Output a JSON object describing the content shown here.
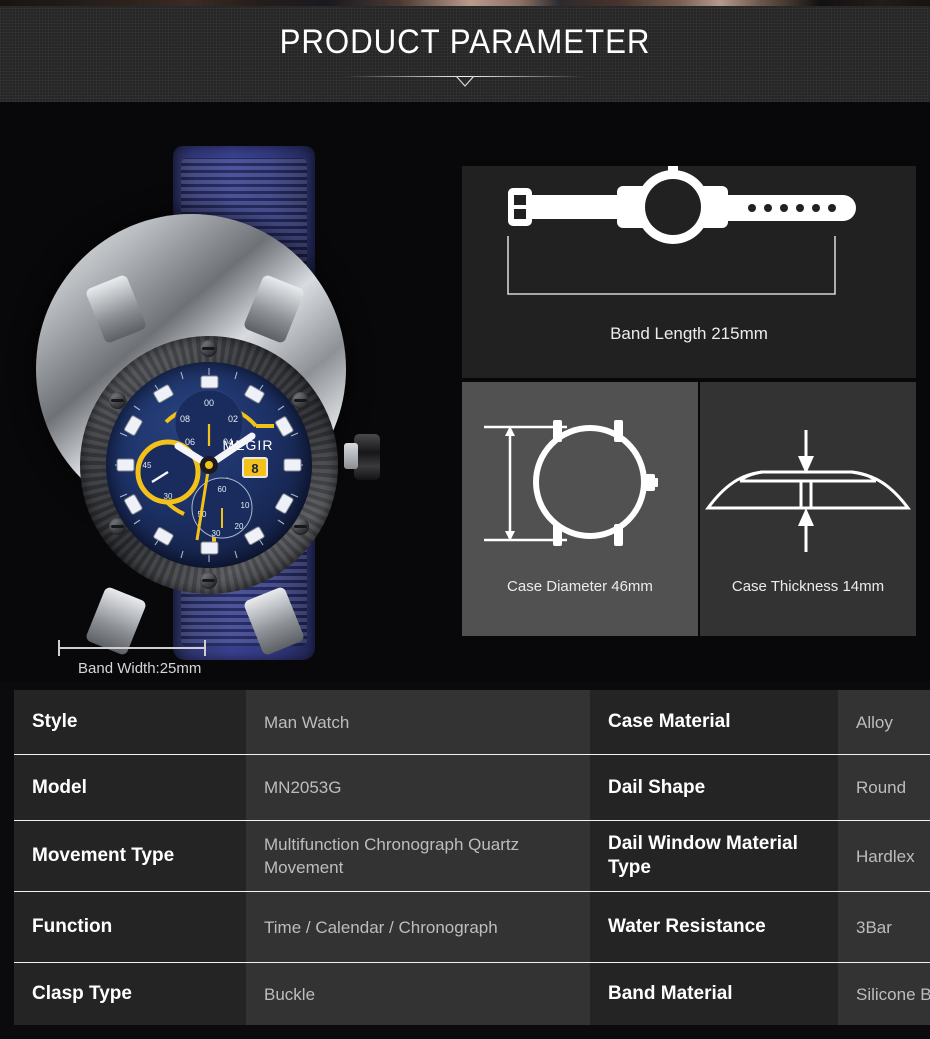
{
  "header": {
    "title": "PRODUCT PARAMETER"
  },
  "product_image": {
    "brand_on_dial": "MEGIR",
    "date_window_value": "8",
    "subdial_top_labels": [
      "00",
      "02",
      "04",
      "06",
      "08"
    ],
    "subdial_left_labels": [
      "30",
      "45"
    ],
    "subdial_bottom_labels": [
      "60",
      "10",
      "20",
      "30",
      "50"
    ],
    "band_width_caption": "Band Width:25mm",
    "colors": {
      "strap": "#343c85",
      "dial": "#1d3268",
      "accent": "#f2c21a",
      "case": "#c8cbcf",
      "bezel": "#3a3b3f"
    }
  },
  "diagrams": [
    {
      "name": "band-length",
      "caption": "Band Length 215mm",
      "background": "#212121",
      "strap_holes": 6
    },
    {
      "name": "case-diameter",
      "caption": "Case Diameter 46mm",
      "background": "#515151"
    },
    {
      "name": "case-thickness",
      "caption": "Case Thickness 14mm",
      "background": "#333333"
    }
  ],
  "spec_table": {
    "rows": [
      {
        "label_left": "Style",
        "value_left": "Man Watch",
        "label_right": "Case Material",
        "value_right": "Alloy"
      },
      {
        "label_left": "Model",
        "value_left": "MN2053G",
        "label_right": "Dail Shape",
        "value_right": "Round"
      },
      {
        "label_left": "Movement Type",
        "value_left": "Multifunction Chronograph Quartz Movement",
        "label_right": "Dail Window Material Type",
        "value_right": "Hardlex"
      },
      {
        "label_left": "Function",
        "value_left": "Time  / Calendar / Chronograph",
        "label_right": "Water Resistance",
        "value_right": "3Bar"
      },
      {
        "label_left": "Clasp Type",
        "value_left": "Buckle",
        "label_right": "Band Material",
        "value_right": "Silicone Band"
      }
    ]
  }
}
